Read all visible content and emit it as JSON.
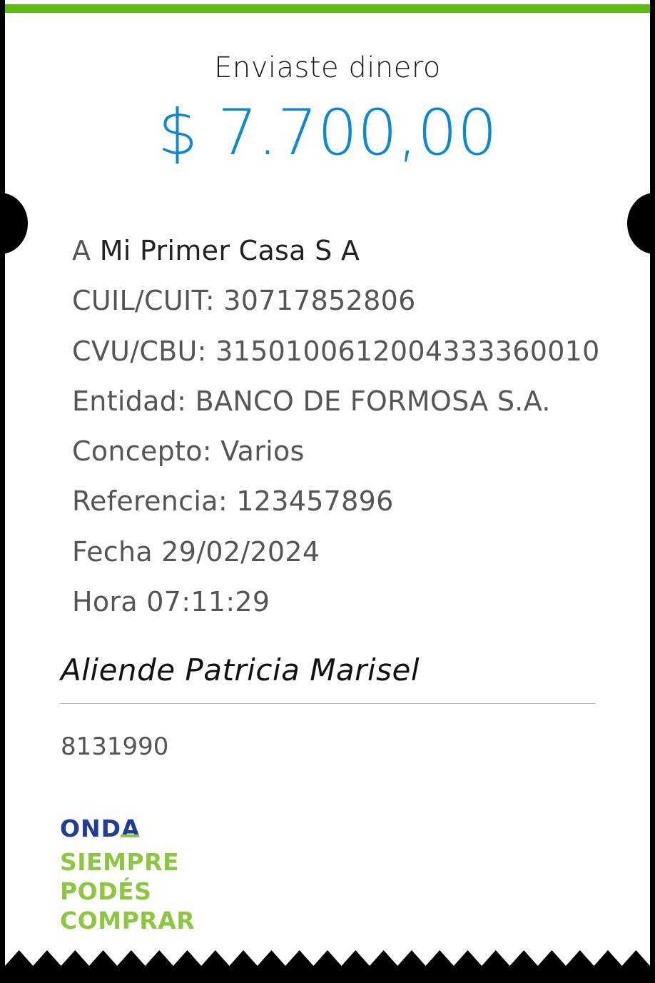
{
  "header": {
    "title": "Enviaste dinero",
    "amount": "$ 7.700,00"
  },
  "details": {
    "recipient_prefix": "A ",
    "recipient_name": "Mi Primer Casa S A",
    "cuil_cuit": "CUIL/CUIT: 30717852806",
    "cvu_cbu": "CVU/CBU: 3150100612004333360010",
    "entidad": "Entidad: BANCO DE FORMOSA S.A.",
    "concepto": "Concepto: Varios",
    "referencia": "Referencia: 123457896",
    "fecha": "Fecha 29/02/2024",
    "hora": "Hora 07:11:29"
  },
  "sender": {
    "name": "Aliende Patricia Marisel",
    "id": "8131990"
  },
  "brand": {
    "name": "ONDA",
    "slogan_1": "SIEMPRE",
    "slogan_2": "PODÉS",
    "slogan_3": "COMPRAR"
  },
  "colors": {
    "accent_green": "#5ebb13",
    "amount_blue": "#0f88d2",
    "brand_navy": "#1f3c99",
    "brand_green": "#8dc63f"
  }
}
